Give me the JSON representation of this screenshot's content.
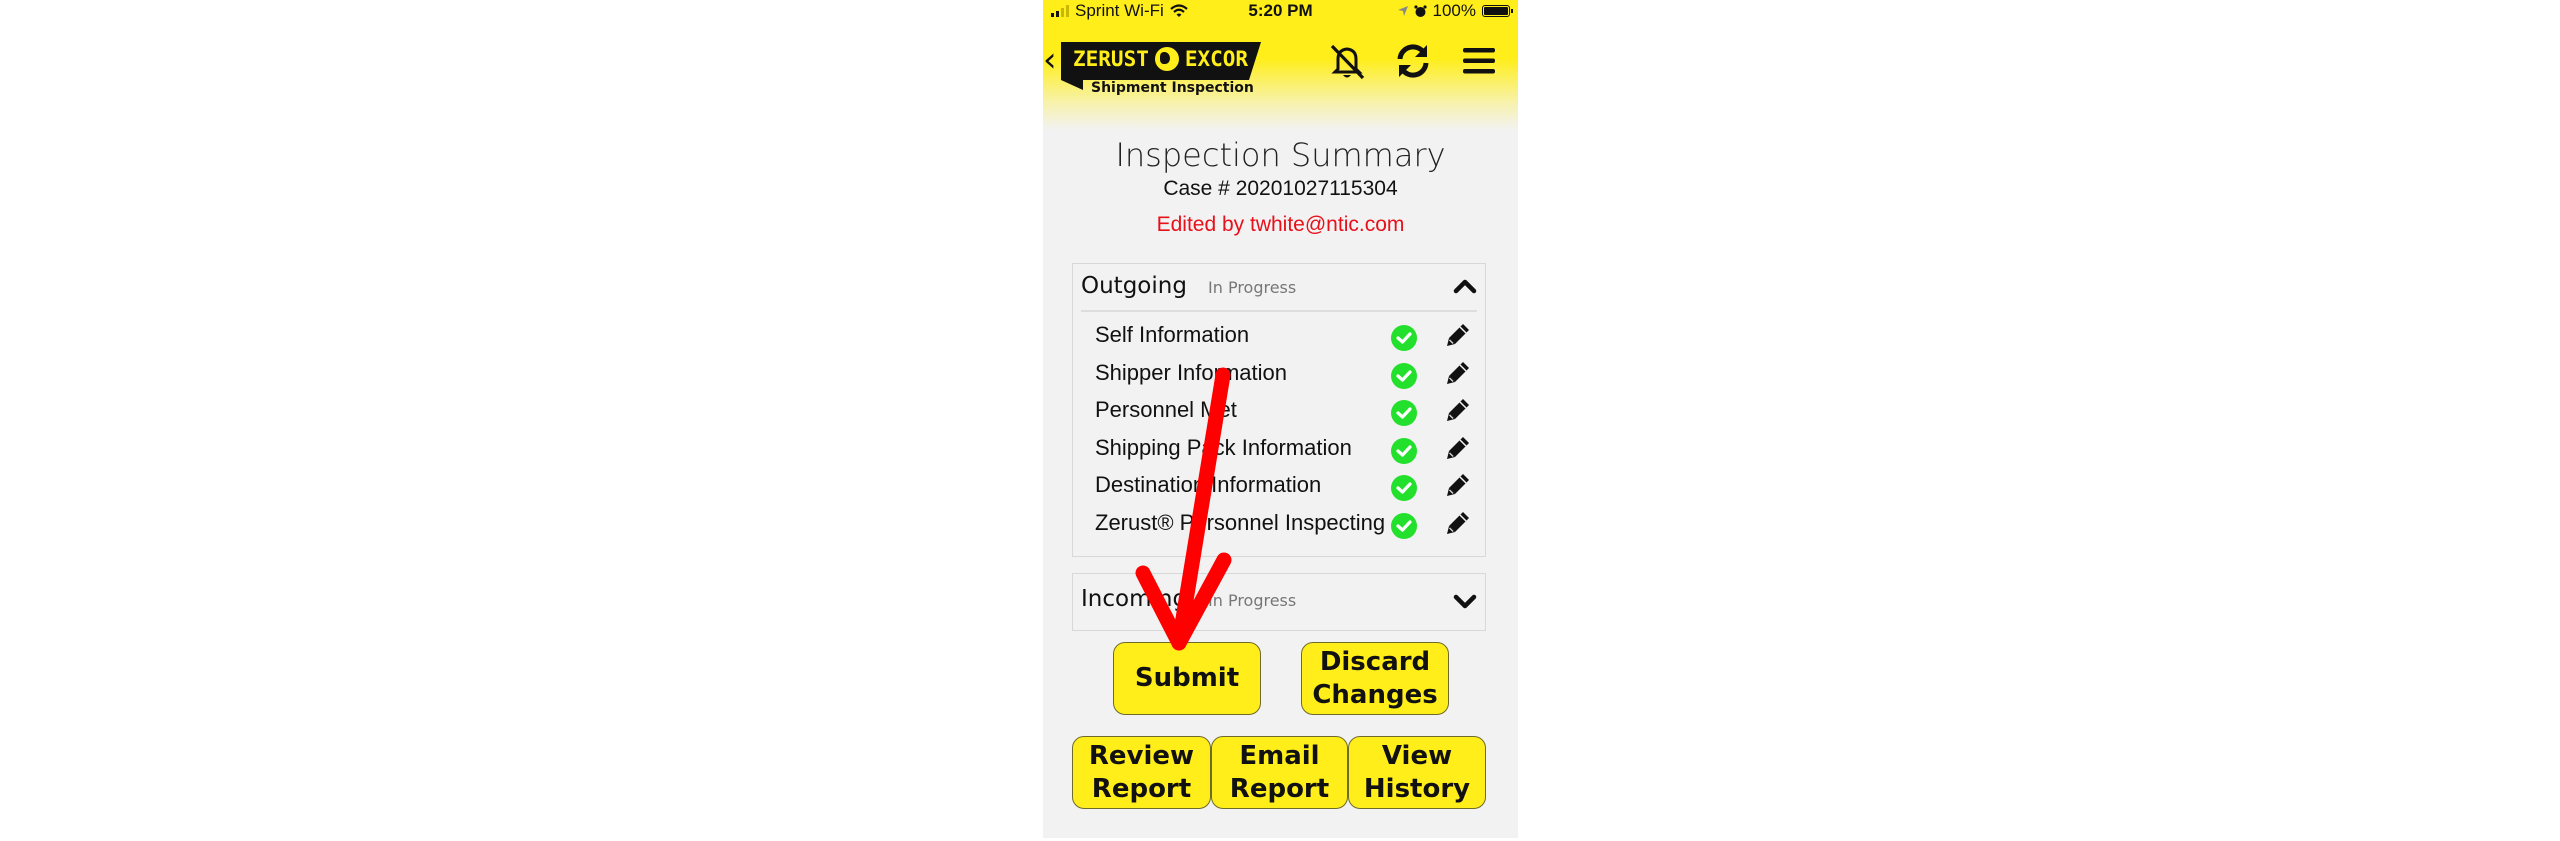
{
  "status_bar": {
    "carrier": "Sprint Wi-Fi",
    "time": "5:20 PM",
    "battery": "100%"
  },
  "header": {
    "logo_brand_left": "ZERUST",
    "logo_brand_right": "EXCOR",
    "logo_subtitle": "Shipment Inspection",
    "icons": [
      "back-chevron-icon",
      "notifications-off-icon",
      "sync-icon",
      "menu-icon"
    ]
  },
  "summary": {
    "title": "Inspection Summary",
    "case": "Case # 20201027115304",
    "edited_by": "Edited by twhite@ntic.com"
  },
  "sections": [
    {
      "name": "Outgoing",
      "status": "In Progress",
      "expanded": true,
      "items": [
        {
          "label": "Self Information",
          "complete": true
        },
        {
          "label": "Shipper Information",
          "complete": true
        },
        {
          "label": "Personnel Met",
          "complete": true
        },
        {
          "label": "Shipping Pack Information",
          "complete": true
        },
        {
          "label": "Destination Information",
          "complete": true
        },
        {
          "label": "Zerust® Personnel Inspecting",
          "complete": true
        }
      ]
    },
    {
      "name": "Incoming",
      "status": "In Progress",
      "expanded": false,
      "items": []
    }
  ],
  "actions": {
    "submit": "Submit",
    "discard": "Discard\nChanges",
    "review_report": "Review\nReport",
    "email_report": "Email\nReport",
    "view_history": "View\nHistory"
  },
  "colors": {
    "brand_yellow": "#ffee1a",
    "check_green": "#22e02c",
    "edited_red": "#e8101a",
    "annotation_red": "#ff0000"
  },
  "annotation": {
    "type": "arrow",
    "target": "submit-button"
  }
}
